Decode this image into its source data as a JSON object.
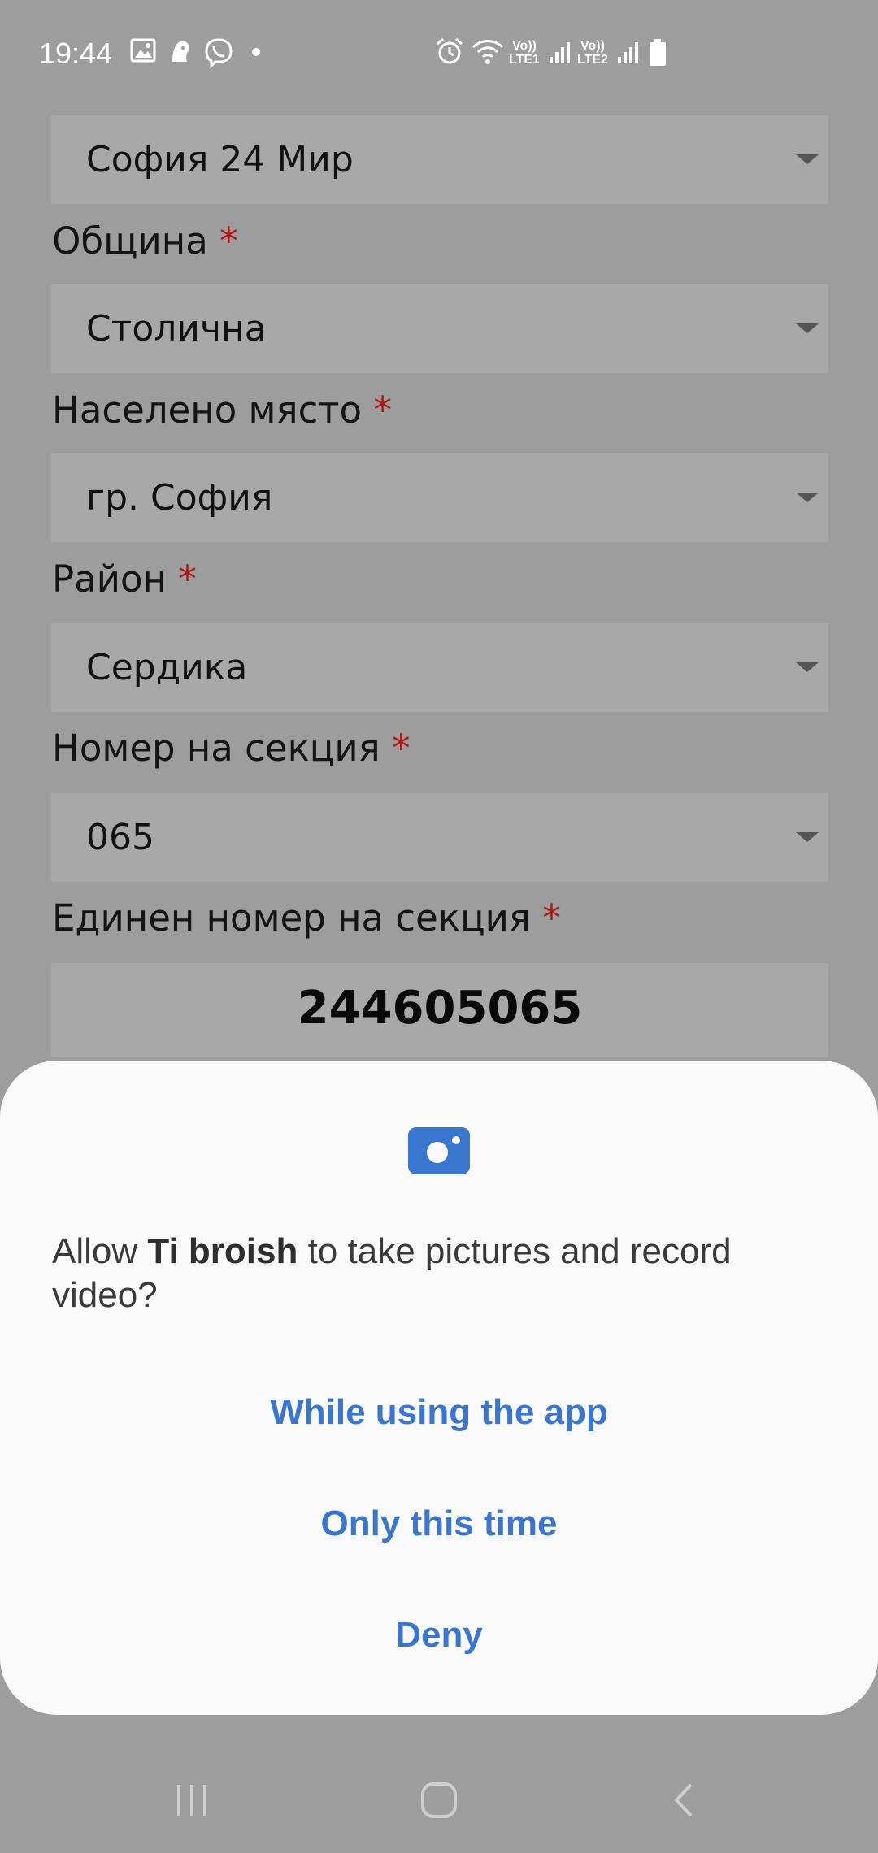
{
  "status_bar": {
    "time": "19:44",
    "icons": [
      "gallery-icon",
      "premier-league-icon",
      "viber-icon",
      "notification-dot",
      "alarm-icon",
      "wifi-icon",
      "signal-icon",
      "signal-icon",
      "battery-icon"
    ],
    "sim1_label_top": "Vo))",
    "sim1_label_bottom": "LTE1",
    "sim2_label_top": "Vo))",
    "sim2_label_bottom": "LTE2"
  },
  "form": {
    "first_select_value": "София 24 Мир",
    "municipality": {
      "label": "Община",
      "required_mark": "*",
      "value": "Столична"
    },
    "settlement": {
      "label": "Населено място",
      "required_mark": "*",
      "value": "гр. София"
    },
    "district": {
      "label": "Район",
      "required_mark": "*",
      "value": "Сердика"
    },
    "section_number": {
      "label": "Номер на секция",
      "required_mark": "*",
      "value": "065"
    },
    "unique_section_number": {
      "label": "Единен номер на секция",
      "required_mark": "*",
      "value": "244605065"
    }
  },
  "dialog": {
    "icon": "camera-icon",
    "message_prefix": "Allow ",
    "app_name": "Ti broish",
    "message_suffix": " to take pictures and record video?",
    "buttons": {
      "while_using": "While using the app",
      "only_this_time": "Only this time",
      "deny": "Deny"
    },
    "accent_color": "#3a76cf"
  },
  "nav_bar": {
    "icons": [
      "recent-apps-icon",
      "home-icon",
      "back-icon"
    ]
  }
}
